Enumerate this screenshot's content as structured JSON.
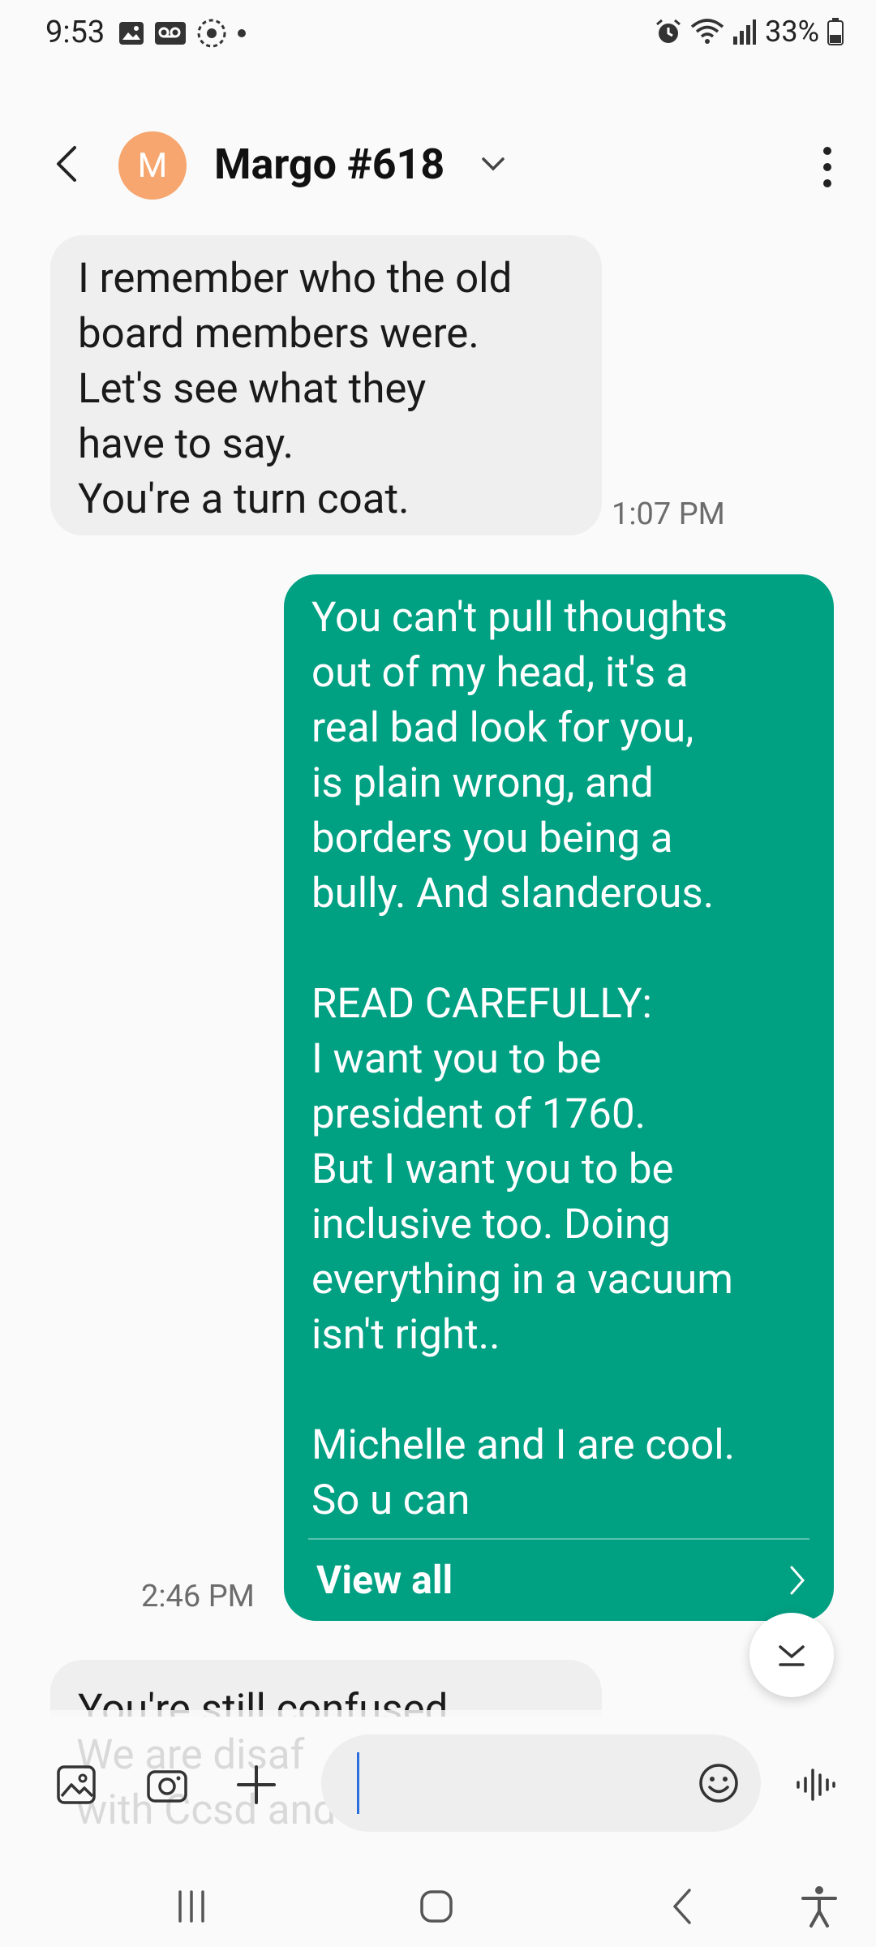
{
  "status_bar": {
    "time": "9:53",
    "battery": "33%"
  },
  "header": {
    "avatar_initial": "M",
    "contact_name": "Margo #618"
  },
  "messages": [
    {
      "direction": "incoming",
      "lines": [
        "I remember who the old",
        "board members were.",
        "Let's see what they",
        "have to say.",
        "You're a turn coat."
      ],
      "time": "1:07 PM"
    },
    {
      "direction": "outgoing",
      "lines": [
        "You can't pull thoughts",
        "out of my head, it's a",
        "real bad look for you,",
        "is plain wrong, and",
        "borders you being a",
        "bully. And slanderous.",
        "",
        "READ CAREFULLY:",
        "I want you to be",
        "president of 1760.",
        "But I want you to be",
        "inclusive too. Doing",
        "everything in a vacuum",
        "isn't right..",
        "",
        "Michelle and I are cool.",
        "So u can"
      ],
      "view_all": "View all",
      "time": "2:46 PM"
    },
    {
      "direction": "incoming",
      "lines": [
        "You're still confused."
      ],
      "faded_lines": [
        "We are disaf",
        "with Ccsd and have"
      ]
    }
  ],
  "colors": {
    "outgoing_bubble": "#00a083",
    "incoming_bubble": "#efefef",
    "avatar": "#f6a66e"
  }
}
